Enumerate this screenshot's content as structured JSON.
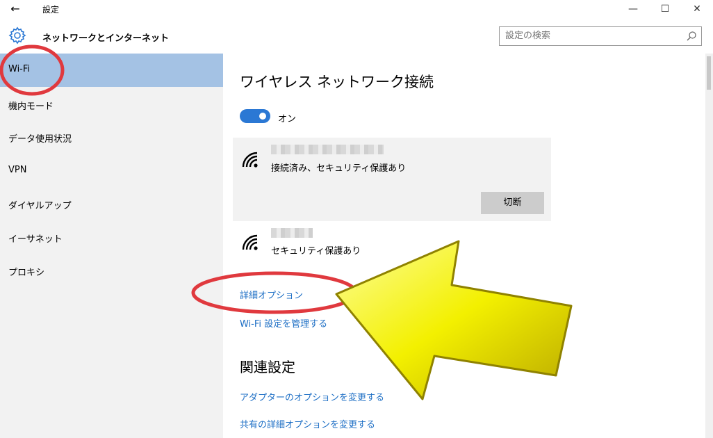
{
  "titlebar": {
    "back_icon": "back-arrow-icon",
    "title": "設定",
    "minimize_icon": "minimize-icon",
    "maximize_icon": "maximize-icon",
    "close_icon": "close-icon"
  },
  "header": {
    "icon": "gear-icon",
    "title": "ネットワークとインターネット",
    "search_placeholder": "設定の検索"
  },
  "sidebar": {
    "items": [
      {
        "label": "Wi-Fi",
        "active": true
      },
      {
        "label": "機内モード",
        "active": false
      },
      {
        "label": "データ使用状況",
        "active": false
      },
      {
        "label": "VPN",
        "active": false
      },
      {
        "label": "ダイヤルアップ",
        "active": false
      },
      {
        "label": "イーサネット",
        "active": false
      },
      {
        "label": "プロキシ",
        "active": false
      }
    ]
  },
  "main": {
    "heading": "ワイヤレス ネットワーク接続",
    "toggle": {
      "state": "on",
      "label": "オン",
      "color": "#2b78d4"
    },
    "networks": [
      {
        "status": "接続済み、セキュリティ保護あり",
        "selected": true,
        "action": "切断"
      },
      {
        "status": "セキュリティ保護あり",
        "selected": false
      }
    ],
    "links": {
      "advanced": "詳細オプション",
      "manage": "Wi-Fi 設定を管理する"
    },
    "related": {
      "heading": "関連設定",
      "adapter": "アダプターのオプションを変更する",
      "sharing": "共有の詳細オプションを変更する"
    }
  },
  "annotations": {
    "circle_color": "#e0393e",
    "arrow_color": "#f3f000"
  }
}
